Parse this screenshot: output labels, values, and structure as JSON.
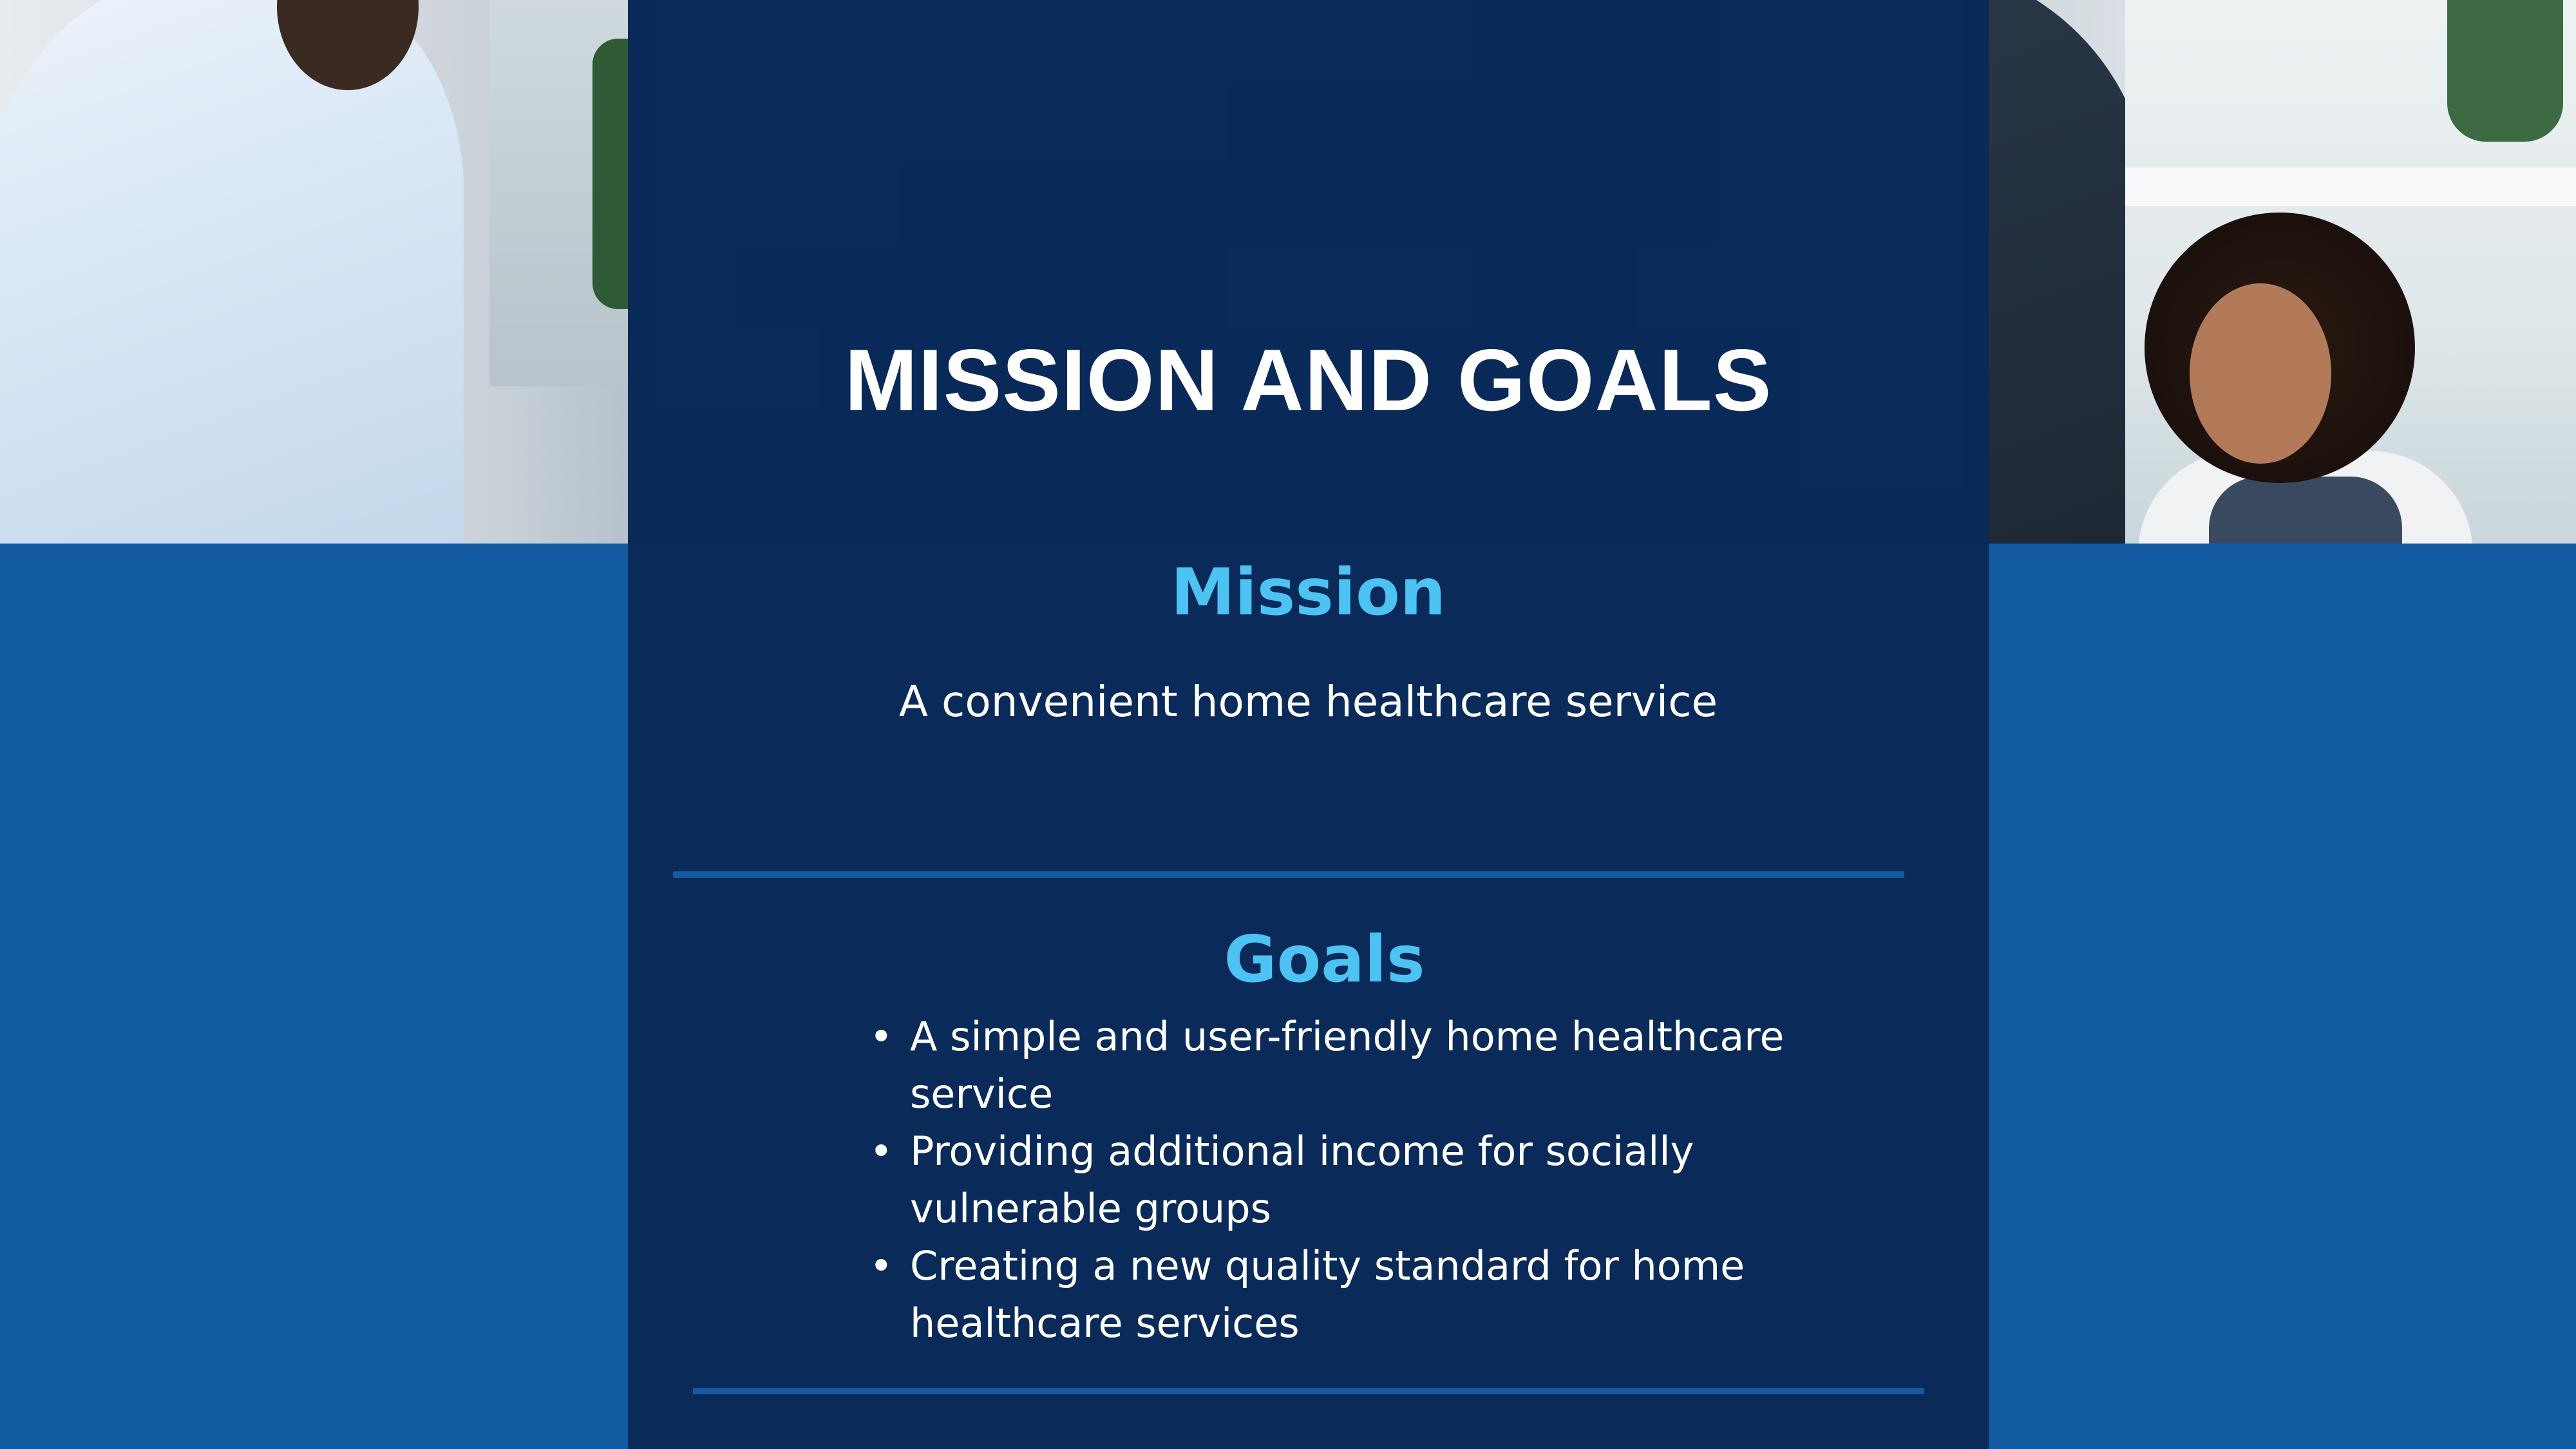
{
  "slide": {
    "title": "MISSION AND GOALS",
    "background_color": "#135ba1",
    "panel_color": "#0a2a59",
    "accent_color": "#4cc3f2"
  },
  "mission": {
    "heading": "Mission",
    "text": "A convenient home healthcare service"
  },
  "goals": {
    "heading": "Goals",
    "bullet": "•",
    "items": [
      "A simple and user-friendly home healthcare service",
      "Providing additional income for socially vulnerable groups",
      "Creating a new quality standard for home healthcare services"
    ]
  }
}
